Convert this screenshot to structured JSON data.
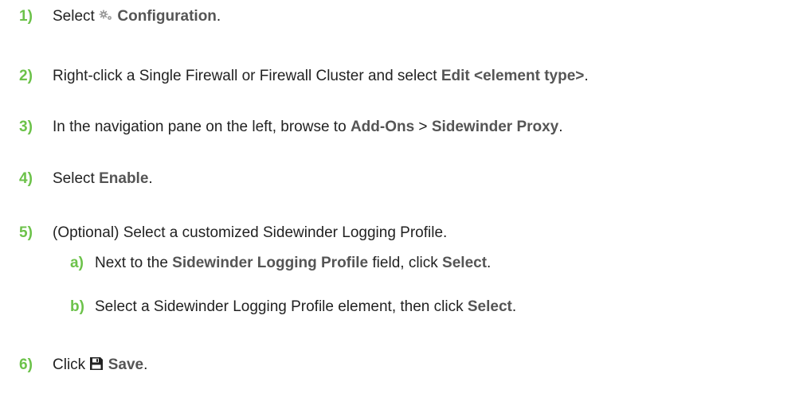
{
  "steps": [
    {
      "num": "1)",
      "parts": [
        "Select ",
        "Configuration",
        "."
      ]
    },
    {
      "num": "2)",
      "parts": [
        "Right-click a Single Firewall or Firewall Cluster and select ",
        "Edit <element type>",
        "."
      ]
    },
    {
      "num": "3)",
      "parts": [
        "In the navigation pane on the left, browse to ",
        "Add-Ons",
        " > ",
        "Sidewinder Proxy",
        "."
      ]
    },
    {
      "num": "4)",
      "parts": [
        "Select ",
        "Enable",
        "."
      ]
    },
    {
      "num": "5)",
      "parts": [
        "(Optional) Select a customized Sidewinder Logging Profile."
      ],
      "substeps": [
        {
          "num": "a)",
          "parts": [
            "Next to the ",
            "Sidewinder Logging Profile",
            " field, click ",
            "Select",
            "."
          ]
        },
        {
          "num": "b)",
          "parts": [
            "Select a Sidewinder Logging Profile element, then click ",
            "Select",
            "."
          ]
        }
      ]
    },
    {
      "num": "6)",
      "parts": [
        "Click ",
        "Save",
        "."
      ]
    }
  ],
  "icons": {
    "configuration": "gear-icon",
    "save": "save-icon"
  },
  "colors": {
    "step_number": "#6cc24a",
    "ui_term": "#555555",
    "text": "#222222"
  }
}
